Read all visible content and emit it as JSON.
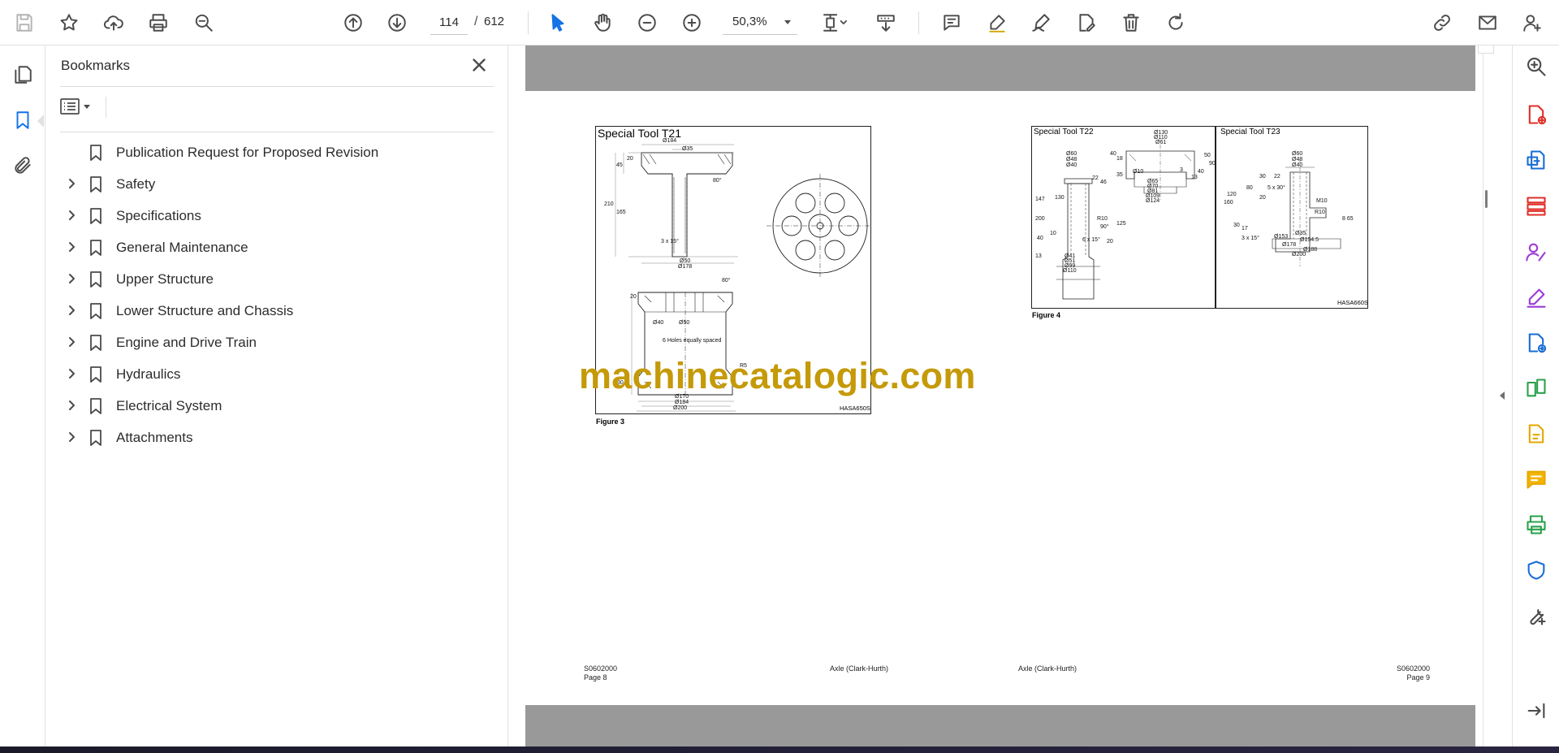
{
  "toolbar": {
    "current_page": "114",
    "page_separator": "/",
    "total_pages": "612",
    "zoom": "50,3%"
  },
  "bookmarks": {
    "title": "Bookmarks",
    "items": [
      {
        "label": "Publication Request for Proposed Revision",
        "expandable": false
      },
      {
        "label": "Safety",
        "expandable": true
      },
      {
        "label": "Specifications",
        "expandable": true
      },
      {
        "label": "General Maintenance",
        "expandable": true
      },
      {
        "label": "Upper Structure",
        "expandable": true
      },
      {
        "label": "Lower Structure and Chassis",
        "expandable": true
      },
      {
        "label": "Engine and Drive Train",
        "expandable": true
      },
      {
        "label": "Hydraulics",
        "expandable": true
      },
      {
        "label": "Electrical System",
        "expandable": true
      },
      {
        "label": "Attachments",
        "expandable": true
      }
    ]
  },
  "document": {
    "left_page": {
      "figure_title": "Special Tool T21",
      "figure_caption": "Figure 3",
      "figure_code": "HASA650S",
      "footer_code": "S0602000",
      "footer_page": "Page 8",
      "footer_section": "Axle (Clark-Hurth)",
      "dims": {
        "d184": "Ø184",
        "d35": "Ø35",
        "h20": "20",
        "h45": "45",
        "h210": "210",
        "h165": "165",
        "ang80": "80°",
        "ch3x15": "3 x 15°",
        "d50": "Ø50",
        "d178": "Ø178",
        "ang80b": "80°",
        "h20b": "20",
        "d40": "Ø40",
        "d50b": "Ø50",
        "holes": "6 Holes equally spaced",
        "h30": "30",
        "r5": "R5",
        "d170": "Ø170",
        "d184b": "Ø184",
        "d200": "Ø200"
      }
    },
    "right_page": {
      "figure_title_a": "Special Tool T22",
      "figure_title_b": "Special Tool T23",
      "figure_caption": "Figure 4",
      "figure_code": "HASA660S",
      "footer_code": "S0602000",
      "footer_page": "Page 9",
      "footer_section": "Axle (Clark-Hurth)",
      "dims_a": {
        "d130": "Ø130",
        "d110": "Ø110",
        "d61": "Ø61",
        "d60": "Ø60",
        "d48": "Ø48",
        "d40": "Ø40",
        "n40": "40",
        "n18": "18",
        "n50": "50",
        "n90": "90",
        "n22": "22",
        "n35": "35",
        "n46": "46",
        "d10": "Ø10",
        "n3": "3",
        "n40b": "40",
        "n13": "13",
        "d65": "Ø65",
        "d70": "Ø70",
        "d81": "Ø81",
        "d109": "Ø109",
        "d124": "Ø124",
        "n147": "147",
        "n130": "130",
        "r10": "R10",
        "a90": "90°",
        "n125": "125",
        "n200": "200",
        "n10": "10",
        "n40c": "40",
        "ch": "6 x 15°",
        "n20": "20",
        "d41": "Ø41",
        "d51": "Ø51",
        "d99": "Ø99",
        "d110b": "Ø110",
        "n13b": "13"
      },
      "dims_b": {
        "d60": "Ø60",
        "d48": "Ø48",
        "d40": "Ø40",
        "n30": "30",
        "n22": "22",
        "n80": "80",
        "ch5x30": "5 x 30°",
        "n20": "20",
        "n120": "120",
        "m10": "M10",
        "n160": "160",
        "r10": "R10",
        "n65": "8 65",
        "n30b": "30",
        "n17": "17",
        "ch3x15": "3 x 15°",
        "d35": "Ø35",
        "d153": "Ø153",
        "d154": "Ø154.5",
        "d178": "Ø178",
        "d188": "Ø188",
        "d200": "Ø200"
      }
    },
    "watermark": "machinecatalogic.com"
  }
}
